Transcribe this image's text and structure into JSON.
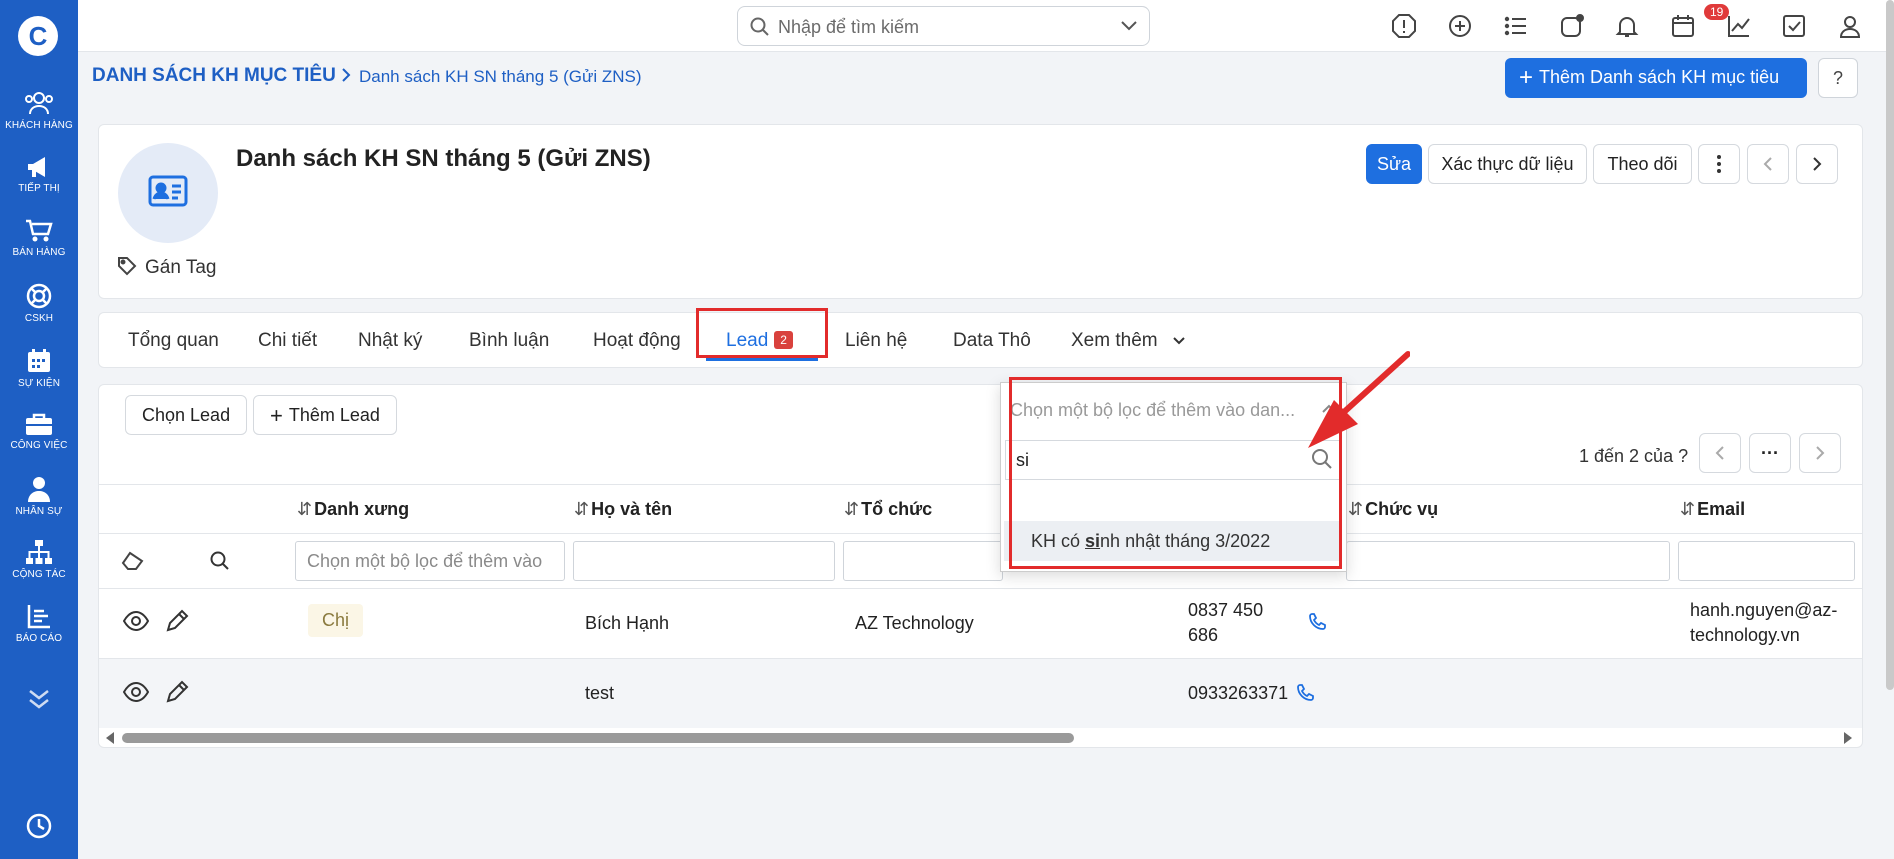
{
  "sidebar": {
    "logo": "C",
    "items": [
      {
        "label": "KHÁCH HÀNG",
        "icon": "customers-icon"
      },
      {
        "label": "TIẾP THỊ",
        "icon": "megaphone-icon"
      },
      {
        "label": "BÁN HÀNG",
        "icon": "cart-icon"
      },
      {
        "label": "CSKH",
        "icon": "lifebuoy-icon"
      },
      {
        "label": "SỰ KIỆN",
        "icon": "calendar-icon"
      },
      {
        "label": "CÔNG VIỆC",
        "icon": "briefcase-icon"
      },
      {
        "label": "NHÂN SỰ",
        "icon": "person-icon"
      },
      {
        "label": "CỘNG TÁC",
        "icon": "network-icon"
      },
      {
        "label": "BÁO CÁO",
        "icon": "report-icon"
      }
    ]
  },
  "topbar": {
    "search_placeholder": "Nhập để tìm kiếm",
    "notification_count": "19"
  },
  "header": {
    "breadcrumb_root": "DANH SÁCH KH MỤC TIÊU",
    "breadcrumb_current": "Danh sách KH SN tháng 5 (Gửi ZNS)",
    "add_button": "Thêm Danh sách KH mục tiêu",
    "help": "?"
  },
  "record": {
    "title": "Danh sách KH SN tháng 5 (Gửi ZNS)",
    "tag_label": "Gán Tag",
    "edit": "Sửa",
    "verify": "Xác thực dữ liệu",
    "follow": "Theo dõi"
  },
  "tabs": {
    "items": [
      "Tổng quan",
      "Chi tiết",
      "Nhật ký",
      "Bình luận",
      "Hoạt động"
    ],
    "active_label": "Lead",
    "active_count": "2",
    "after": [
      "Liên hệ",
      "Data Thô"
    ],
    "more": "Xem thêm"
  },
  "toolbar": {
    "choose_lead": "Chọn Lead",
    "add_lead": "Thêm Lead"
  },
  "pager": {
    "text": "1 đến 2 của",
    "unknown": "?",
    "more": "···"
  },
  "table": {
    "columns": [
      "Danh xưng",
      "Họ và tên",
      "Tổ chức",
      "Chức vụ",
      "Email"
    ],
    "filter_placeholder": "Chọn một bộ lọc để thêm vào",
    "rows": [
      {
        "title": "Chị",
        "name": "Bích Hạnh",
        "org": "AZ Technology",
        "phone_1": "0837 450",
        "phone_2": "686",
        "email_1": "hanh.nguyen@az-",
        "email_2": "technology.vn"
      },
      {
        "title": "",
        "name": "test",
        "org": "",
        "phone_1": "0933263371",
        "phone_2": "",
        "email_1": "",
        "email_2": ""
      }
    ]
  },
  "dropdown": {
    "placeholder": "Chọn một bộ lọc để thêm vào dan...",
    "search_value": "si",
    "option_prefix": "KH có ",
    "option_match": "si",
    "option_suffix": "nh nhật tháng 3/2022"
  },
  "colors": {
    "brand": "#1e5fc4",
    "primary_button": "#1e6fe0",
    "highlight_box": "#e22b2b",
    "badge": "#e03a3a"
  }
}
